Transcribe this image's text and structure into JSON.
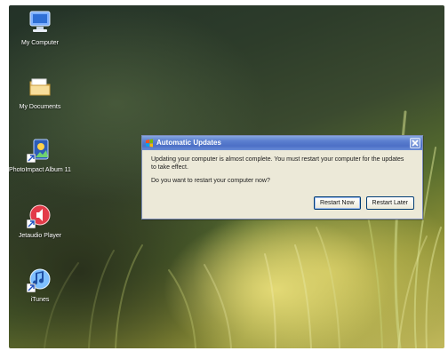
{
  "desktop": {
    "icons": [
      {
        "label": "My Computer",
        "icon": "computer-icon"
      },
      {
        "label": "My Documents",
        "icon": "folder-documents-icon"
      },
      {
        "label": "PhotoImpact Album 11",
        "icon": "photoimpact-icon"
      },
      {
        "label": "Jetaudio Player",
        "icon": "audio-player-icon"
      },
      {
        "label": "iTunes",
        "icon": "itunes-icon"
      }
    ]
  },
  "dialog": {
    "title": "Automatic Updates",
    "message": "Updating your computer is almost complete. You must restart your computer for the updates to take effect.",
    "question": "Do you want to restart your computer now?",
    "buttons": {
      "restart_now": "Restart Now",
      "restart_later": "Restart Later"
    },
    "close_icon": "close-icon",
    "title_icon": "windows-update-icon"
  },
  "colors": {
    "titlebar": "#5b7fcf",
    "dialog_bg": "#ece9d8"
  }
}
